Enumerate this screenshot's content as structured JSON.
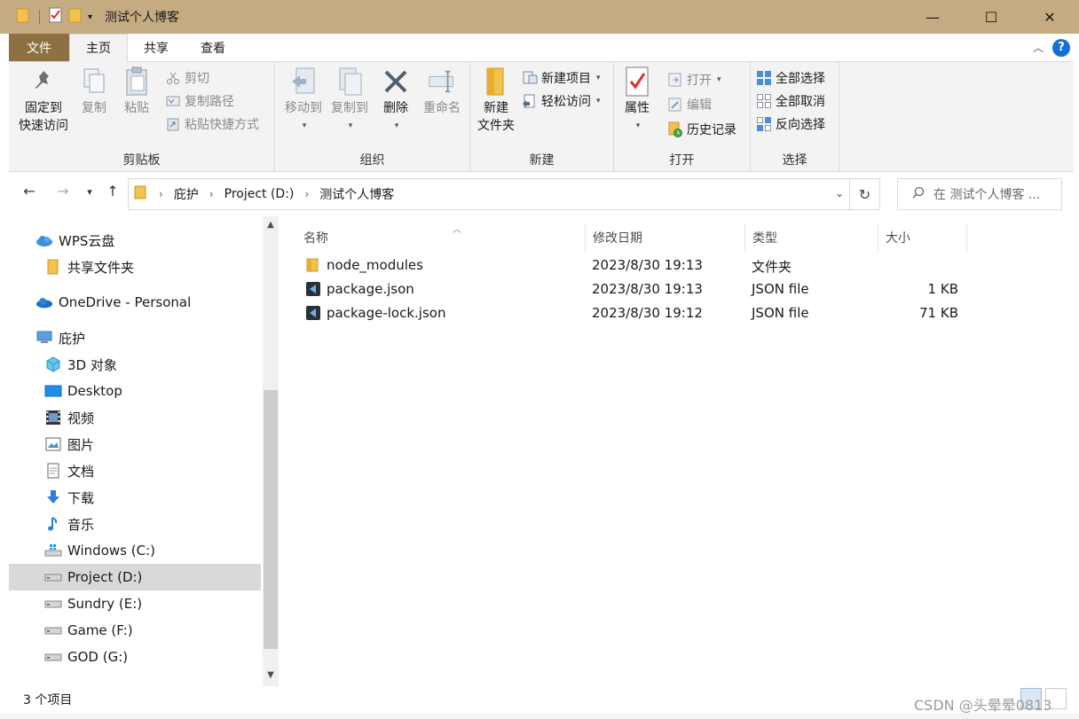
{
  "window": {
    "title": "测试个人博客",
    "minimize": "—",
    "maximize": "☐",
    "close": "✕"
  },
  "tabs": {
    "file": "文件",
    "home": "主页",
    "share": "共享",
    "view": "查看"
  },
  "ribbon": {
    "clipboard": {
      "label": "剪贴板",
      "pin": "固定到\n快速访问",
      "copy": "复制",
      "paste": "粘贴",
      "cut": "剪切",
      "copy_path": "复制路径",
      "paste_shortcut": "粘贴快捷方式"
    },
    "organize": {
      "label": "组织",
      "move_to": "移动到",
      "copy_to": "复制到",
      "delete": "删除",
      "rename": "重命名"
    },
    "new": {
      "label": "新建",
      "new_folder": "新建\n文件夹",
      "new_item": "新建项目",
      "easy_access": "轻松访问"
    },
    "open": {
      "label": "打开",
      "properties": "属性",
      "open": "打开",
      "edit": "编辑",
      "history": "历史记录"
    },
    "select": {
      "label": "选择",
      "select_all": "全部选择",
      "select_none": "全部取消",
      "invert": "反向选择"
    }
  },
  "address": {
    "crumbs": [
      "庇护",
      "Project (D:)",
      "测试个人博客"
    ],
    "search_placeholder": "在 测试个人博客 ..."
  },
  "nav": {
    "items": [
      {
        "label": "WPS云盘",
        "icon": "cloud-icon"
      },
      {
        "label": "共享文件夹",
        "icon": "folder-icon"
      },
      {
        "label": "OneDrive - Personal",
        "icon": "onedrive-icon"
      },
      {
        "label": "庇护",
        "icon": "pc-icon"
      },
      {
        "label": "3D 对象",
        "icon": "cube-icon"
      },
      {
        "label": "Desktop",
        "icon": "desktop-icon"
      },
      {
        "label": "视频",
        "icon": "video-icon"
      },
      {
        "label": "图片",
        "icon": "picture-icon"
      },
      {
        "label": "文档",
        "icon": "document-icon"
      },
      {
        "label": "下载",
        "icon": "download-icon"
      },
      {
        "label": "音乐",
        "icon": "music-icon"
      },
      {
        "label": "Windows (C:)",
        "icon": "drive-icon"
      },
      {
        "label": "Project (D:)",
        "icon": "drive-icon"
      },
      {
        "label": "Sundry (E:)",
        "icon": "drive-icon"
      },
      {
        "label": "Game (F:)",
        "icon": "drive-icon"
      },
      {
        "label": "GOD (G:)",
        "icon": "drive-icon"
      }
    ]
  },
  "columns": {
    "name": "名称",
    "modified": "修改日期",
    "type": "类型",
    "size": "大小"
  },
  "files": [
    {
      "name": "node_modules",
      "modified": "2023/8/30 19:13",
      "type": "文件夹",
      "size": "",
      "icon": "folder-icon"
    },
    {
      "name": "package.json",
      "modified": "2023/8/30 19:13",
      "type": "JSON file",
      "size": "1 KB",
      "icon": "vscode-file-icon"
    },
    {
      "name": "package-lock.json",
      "modified": "2023/8/30 19:12",
      "type": "JSON file",
      "size": "71 KB",
      "icon": "vscode-file-icon"
    }
  ],
  "status": {
    "count": "3 个项目"
  },
  "watermark": "CSDN @头晕晕0813"
}
